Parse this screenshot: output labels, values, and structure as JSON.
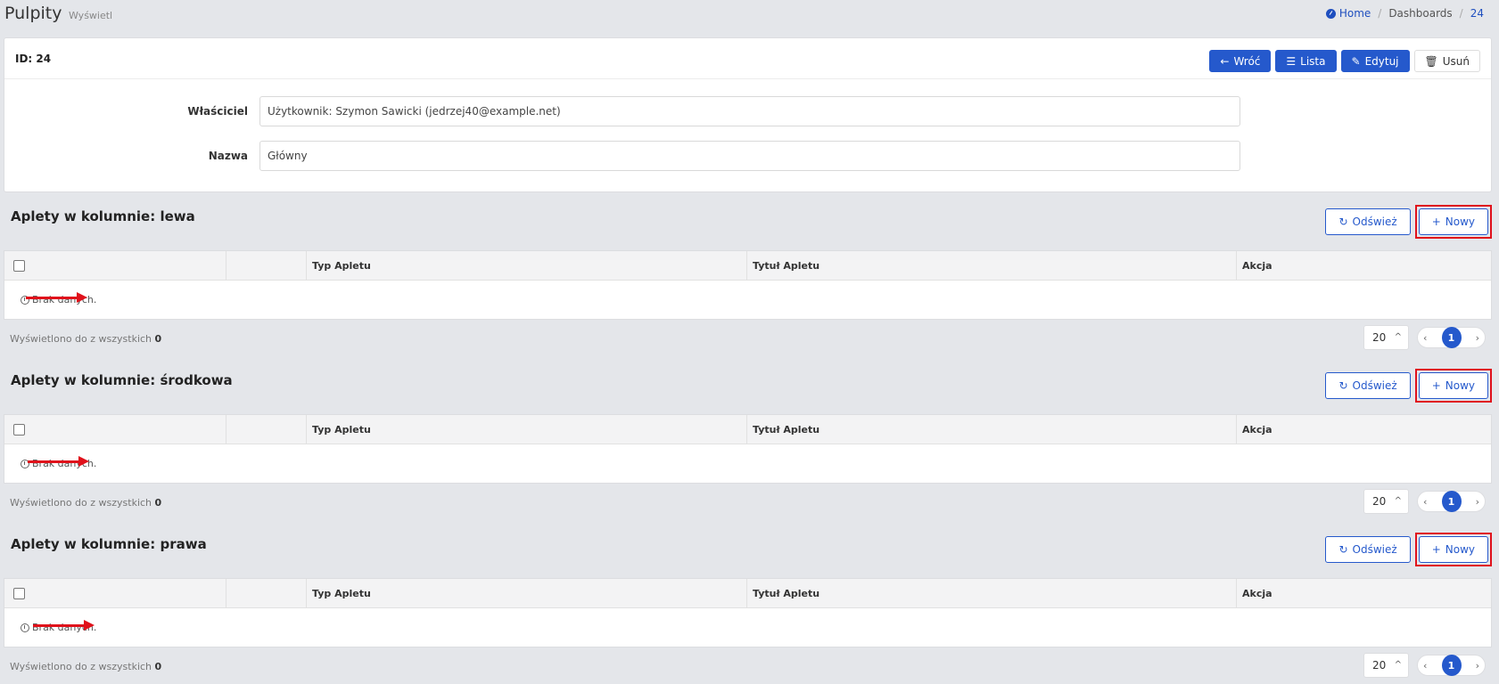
{
  "header": {
    "title": "Pulpity",
    "subtitle": "Wyświetl",
    "breadcrumb": [
      "Home",
      "Dashboards",
      "24"
    ]
  },
  "card": {
    "id_label": "ID: 24",
    "buttons": {
      "back": "Wróć",
      "list": "Lista",
      "edit": "Edytuj",
      "delete": "Usuń"
    },
    "fields": [
      {
        "label": "Właściciel",
        "value": "Użytkownik: Szymon Sawicki (jedrzej40@example.net)"
      },
      {
        "label": "Nazwa",
        "value": "Główny"
      }
    ]
  },
  "sections": [
    {
      "title": "Aplety w kolumnie: lewa",
      "refresh_label": "Odśwież",
      "new_label": "Nowy",
      "columns": [
        "Typ Apletu",
        "Tytuł Apletu",
        "Akcja"
      ],
      "empty_text": "Brak danych.",
      "footer_text": "Wyświetlono do z wszystkich",
      "total": "0",
      "page_size": "20",
      "current_page": "1"
    },
    {
      "title": "Aplety w kolumnie: środkowa",
      "refresh_label": "Odśwież",
      "new_label": "Nowy",
      "columns": [
        "Typ Apletu",
        "Tytuł Apletu",
        "Akcja"
      ],
      "empty_text": "Brak danych.",
      "footer_text": "Wyświetlono do z wszystkich",
      "total": "0",
      "page_size": "20",
      "current_page": "1"
    },
    {
      "title": "Aplety w kolumnie: prawa",
      "refresh_label": "Odśwież",
      "new_label": "Nowy",
      "columns": [
        "Typ Apletu",
        "Tytuł Apletu",
        "Akcja"
      ],
      "empty_text": "Brak danych.",
      "footer_text": "Wyświetlono do z wszystkich",
      "total": "0",
      "page_size": "20",
      "current_page": "1"
    }
  ],
  "colors": {
    "primary": "#2559cc",
    "highlight": "#e0111b",
    "background": "#e4e6ea"
  }
}
